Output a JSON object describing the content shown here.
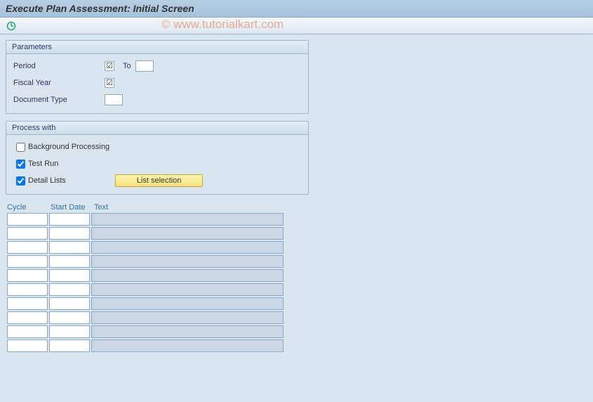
{
  "title": "Execute Plan Assessment: Initial Screen",
  "watermark": "© www.tutorialkart.com",
  "parameters": {
    "title": "Parameters",
    "period_label": "Period",
    "to_label": "To",
    "period_from": "",
    "period_to": "",
    "fiscal_label": "Fiscal Year",
    "fiscal_value": "",
    "doctype_label": "Document Type",
    "doctype_value": ""
  },
  "process": {
    "title": "Process with",
    "background_label": "Background Processing",
    "background_checked": false,
    "testrun_label": "Test Run",
    "testrun_checked": true,
    "detail_label": "Detail Lists",
    "detail_checked": true,
    "list_selection_btn": "List selection"
  },
  "table": {
    "header_cycle": "Cycle",
    "header_date": "Start Date",
    "header_text": "Text",
    "rows": [
      {
        "cycle": "",
        "date": "",
        "text": ""
      },
      {
        "cycle": "",
        "date": "",
        "text": ""
      },
      {
        "cycle": "",
        "date": "",
        "text": ""
      },
      {
        "cycle": "",
        "date": "",
        "text": ""
      },
      {
        "cycle": "",
        "date": "",
        "text": ""
      },
      {
        "cycle": "",
        "date": "",
        "text": ""
      },
      {
        "cycle": "",
        "date": "",
        "text": ""
      },
      {
        "cycle": "",
        "date": "",
        "text": ""
      },
      {
        "cycle": "",
        "date": "",
        "text": ""
      },
      {
        "cycle": "",
        "date": "",
        "text": ""
      }
    ]
  }
}
